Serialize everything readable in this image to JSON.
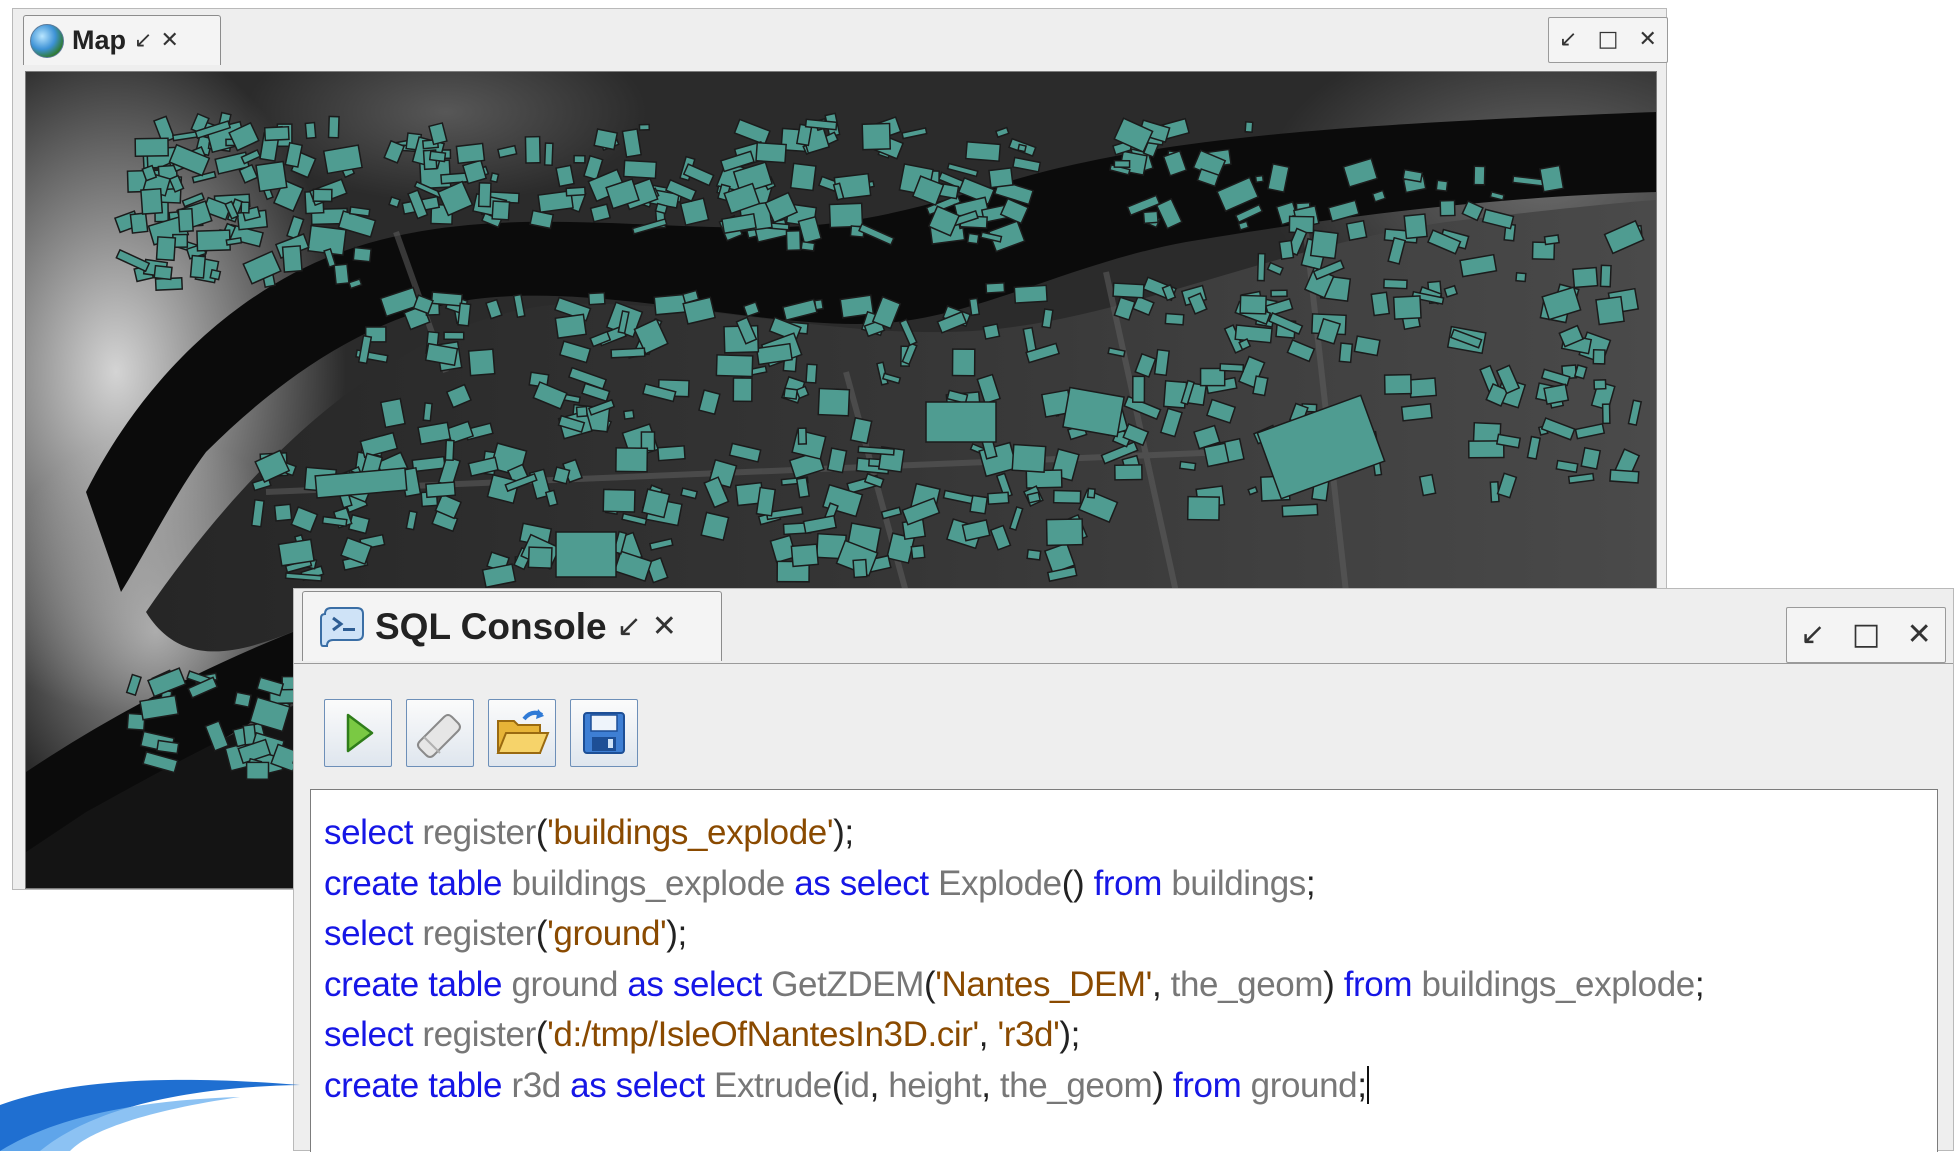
{
  "map_window": {
    "tab_title": "Map",
    "tab_icon": "globe-icon",
    "pin_glyph": "↙",
    "close_glyph": "✕",
    "controls": {
      "pin": "↙",
      "maximize": "□",
      "close": "✕"
    },
    "colors": {
      "background": "#222222",
      "buildings": "#4f9c91",
      "river": "#0a0a0a",
      "terrain_light": "#d8d8d8"
    }
  },
  "sql_console": {
    "tab_title": "SQL Console",
    "tab_icon": "sql-console-icon",
    "pin_glyph": "↙",
    "close_glyph": "✕",
    "controls": {
      "pin": "↙",
      "maximize": "□",
      "close": "✕"
    },
    "toolbar": [
      {
        "name": "execute",
        "icon": "play-icon"
      },
      {
        "name": "clear",
        "icon": "eraser-icon"
      },
      {
        "name": "open",
        "icon": "open-folder-icon"
      },
      {
        "name": "save",
        "icon": "save-disk-icon"
      }
    ],
    "code_lines": [
      [
        {
          "t": "kw",
          "v": "select"
        },
        {
          "t": "sp",
          "v": " "
        },
        {
          "t": "id",
          "v": "register"
        },
        {
          "t": "pn",
          "v": "("
        },
        {
          "t": "str",
          "v": "'buildings_explode'"
        },
        {
          "t": "pn",
          "v": ");"
        }
      ],
      [
        {
          "t": "kw",
          "v": "create table"
        },
        {
          "t": "sp",
          "v": " "
        },
        {
          "t": "id",
          "v": "buildings_explode"
        },
        {
          "t": "sp",
          "v": " "
        },
        {
          "t": "kw",
          "v": "as select"
        },
        {
          "t": "sp",
          "v": " "
        },
        {
          "t": "id",
          "v": "Explode"
        },
        {
          "t": "pn",
          "v": "()"
        },
        {
          "t": "sp",
          "v": " "
        },
        {
          "t": "kw",
          "v": "from"
        },
        {
          "t": "sp",
          "v": " "
        },
        {
          "t": "id",
          "v": "buildings"
        },
        {
          "t": "pn",
          "v": ";"
        }
      ],
      [
        {
          "t": "kw",
          "v": "select"
        },
        {
          "t": "sp",
          "v": " "
        },
        {
          "t": "id",
          "v": "register"
        },
        {
          "t": "pn",
          "v": "("
        },
        {
          "t": "str",
          "v": "'ground'"
        },
        {
          "t": "pn",
          "v": ");"
        }
      ],
      [
        {
          "t": "kw",
          "v": "create table"
        },
        {
          "t": "sp",
          "v": " "
        },
        {
          "t": "id",
          "v": "ground"
        },
        {
          "t": "sp",
          "v": " "
        },
        {
          "t": "kw",
          "v": "as select"
        },
        {
          "t": "sp",
          "v": " "
        },
        {
          "t": "id",
          "v": "GetZDEM"
        },
        {
          "t": "pn",
          "v": "("
        },
        {
          "t": "str",
          "v": "'Nantes_DEM'"
        },
        {
          "t": "pn",
          "v": ","
        },
        {
          "t": "sp",
          "v": " "
        },
        {
          "t": "id",
          "v": "the_geom"
        },
        {
          "t": "pn",
          "v": ")"
        },
        {
          "t": "sp",
          "v": " "
        },
        {
          "t": "kw",
          "v": "from"
        },
        {
          "t": "sp",
          "v": " "
        },
        {
          "t": "id",
          "v": "buildings_explode"
        },
        {
          "t": "pn",
          "v": ";"
        }
      ],
      [
        {
          "t": "kw",
          "v": "select"
        },
        {
          "t": "sp",
          "v": " "
        },
        {
          "t": "id",
          "v": "register"
        },
        {
          "t": "pn",
          "v": "("
        },
        {
          "t": "str",
          "v": "'d:/tmp/IsleOfNantesIn3D.cir'"
        },
        {
          "t": "pn",
          "v": ","
        },
        {
          "t": "sp",
          "v": " "
        },
        {
          "t": "str",
          "v": "'r3d'"
        },
        {
          "t": "pn",
          "v": ");"
        }
      ],
      [
        {
          "t": "kw",
          "v": "create table"
        },
        {
          "t": "sp",
          "v": " "
        },
        {
          "t": "id",
          "v": "r3d"
        },
        {
          "t": "sp",
          "v": " "
        },
        {
          "t": "kw",
          "v": "as select"
        },
        {
          "t": "sp",
          "v": " "
        },
        {
          "t": "id",
          "v": "Extrude"
        },
        {
          "t": "pn",
          "v": "("
        },
        {
          "t": "id",
          "v": "id"
        },
        {
          "t": "pn",
          "v": ","
        },
        {
          "t": "sp",
          "v": " "
        },
        {
          "t": "id",
          "v": "height"
        },
        {
          "t": "pn",
          "v": ","
        },
        {
          "t": "sp",
          "v": " "
        },
        {
          "t": "id",
          "v": "the_geom"
        },
        {
          "t": "pn",
          "v": ")"
        },
        {
          "t": "sp",
          "v": " "
        },
        {
          "t": "kw",
          "v": "from"
        },
        {
          "t": "sp",
          "v": " "
        },
        {
          "t": "id",
          "v": "ground"
        },
        {
          "t": "pn",
          "v": ";"
        }
      ]
    ]
  },
  "colors": {
    "keyword": "#1616e6",
    "identifier": "#777777",
    "string": "#8a4a00",
    "swoosh": "#1f6fd1"
  }
}
